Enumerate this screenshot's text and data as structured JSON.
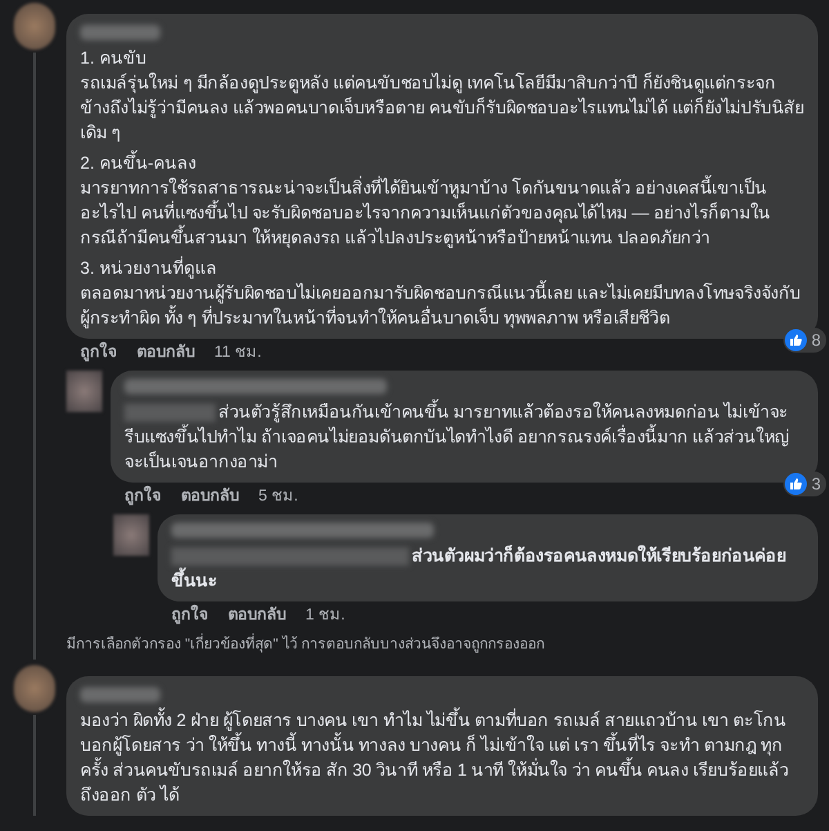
{
  "comments": [
    {
      "sections": [
        {
          "heading": "1. คนขับ",
          "body": "รถเมล์รุ่นใหม่ ๆ มีกล้องดูประตูหลัง แต่คนขับชอบไม่ดู เทคโนโลยีมีมาสิบกว่าปี ก็ยังชินดูแต่กระจกข้างถึงไม่รู้ว่ามีคนลง แล้วพอคนบาดเจ็บหรือตาย คนขับก็รับผิดชอบอะไรแทนไม่ได้ แต่ก็ยังไม่ปรับนิสัยเดิม ๆ"
        },
        {
          "heading": "2. คนขึ้น-คนลง",
          "body": "มารยาทการใช้รถสาธารณะน่าจะเป็นสิ่งที่ได้ยินเข้าหูมาบ้าง โดกันขนาดแล้ว อย่างเคสนี้เขาเป็นอะไรไป คนที่แซงขึ้นไป จะรับผิดชอบอะไรจากความเห็นแก่ตัวของคุณได้ไหม — อย่างไรก็ตามในกรณีถ้ามีคนขึ้นสวนมา ให้หยุดลงรถ แล้วไปลงประตูหน้าหรือป้ายหน้าแทน ปลอดภัยกว่า"
        },
        {
          "heading": "3. หน่วยงานที่ดูแล",
          "body": "ตลอดมาหน่วยงานผู้รับผิดชอบไม่เคยออกมารับผิดชอบกรณีแนวนี้เลย และไม่เคยมีบทลงโทษจริงจังกับผู้กระทำผิด ทั้ง ๆ ที่ประมาทในหน้าที่จนทำให้คนอื่นบาดเจ็บ ทุพพลภาพ หรือเสียชีวิต"
        }
      ],
      "like": "ถูกใจ",
      "reply": "ตอบกลับ",
      "time": "11 ชม.",
      "reactions": "8",
      "replies": [
        {
          "text": "ส่วนตัวรู้สึกเหมือนกันเข้าคนขึ้น มารยาทแล้วต้องรอให้คนลงหมดก่อน ไม่เข้าจะรีบแซงขึ้นไปทำไม ถ้าเจอคนไม่ยอมดันตกบันไดทำไงดี อยากรณรงค์เรื่องนี้มาก แล้วส่วนใหญ่จะเป็นเจนอากงอาม่า",
          "like": "ถูกใจ",
          "reply": "ตอบกลับ",
          "time": "5 ชม.",
          "reactions": "3"
        },
        {
          "text": "ส่วนตัวผมว่าก็ต้องรอคนลงหมดให้เรียบร้อยก่อนค่อยขึ้นนะ",
          "like": "ถูกใจ",
          "reply": "ตอบกลับ",
          "time": "1 ชม."
        }
      ],
      "filter_note": "มีการเลือกตัวกรอง \"เกี่ยวข้องที่สุด\" ไว้ การตอบกลับบางส่วนจึงอาจถูกกรองออก"
    },
    {
      "sections": [
        {
          "body": "มองว่า ผิดทั้ง 2 ฝ่าย ผู้โดยสาร บางคน เขา ทำไม ไม่ขึ้น ตามที่บอก รถเมล์ สายแถวบ้าน เขา ตะโกนบอกผู้โดยสาร ว่า ให้ขึ้น ทางนี้ ทางนั้น ทางลง บางคน ก็ ไม่เข้าใจ แต่ เรา ขึ้นที่ไร จะทำ ตามกฎ ทุกครั้ง ส่วนคนขับรถเมล์ อยากให้รอ สัก 30 วินาที หรือ 1 นาที ให้มั่นใจ ว่า คนขึ้น คนลง เรียบร้อยแล้ว ถึงออก ตัว ได้"
        }
      ]
    }
  ]
}
